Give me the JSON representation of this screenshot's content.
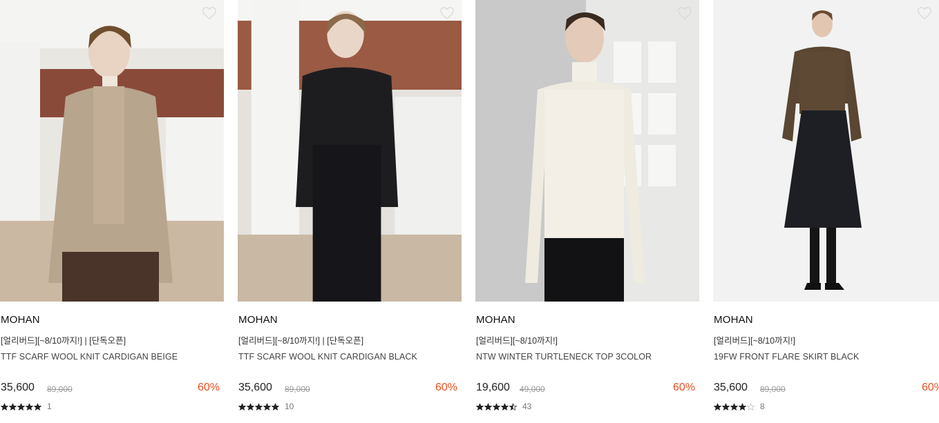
{
  "colors": {
    "discount": "#e8501f",
    "star": "#222222"
  },
  "products": [
    {
      "brand": "MOHAN",
      "promo": "[얼리버드][~8/10까지!] | [단독오픈]",
      "name": "TTF SCARF WOOL KNIT CARDIGAN BEIGE",
      "price": "35,600",
      "original_price": "89,000",
      "discount": "60%",
      "rating": 5,
      "review_count": "1",
      "image_icon": "model-photo-beige-cardigan"
    },
    {
      "brand": "MOHAN",
      "promo": "[얼리버드][~8/10까지!] | [단독오픈]",
      "name": "TTF SCARF WOOL KNIT CARDIGAN BLACK",
      "price": "35,600",
      "original_price": "89,000",
      "discount": "60%",
      "rating": 5,
      "review_count": "10",
      "image_icon": "model-photo-black-cardigan"
    },
    {
      "brand": "MOHAN",
      "promo": "[얼리버드][~8/10까지!]",
      "name": "NTW WINTER TURTLENECK TOP 3COLOR",
      "price": "19,600",
      "original_price": "49,000",
      "discount": "60%",
      "rating": 4.5,
      "review_count": "43",
      "image_icon": "model-photo-ivory-turtleneck"
    },
    {
      "brand": "MOHAN",
      "promo": "[얼리버드][~8/10까지!]",
      "name": "19FW FRONT FLARE SKIRT BLACK",
      "price": "35,600",
      "original_price": "89,000",
      "discount": "60%",
      "rating": 4,
      "review_count": "8",
      "image_icon": "model-photo-flare-skirt"
    }
  ]
}
